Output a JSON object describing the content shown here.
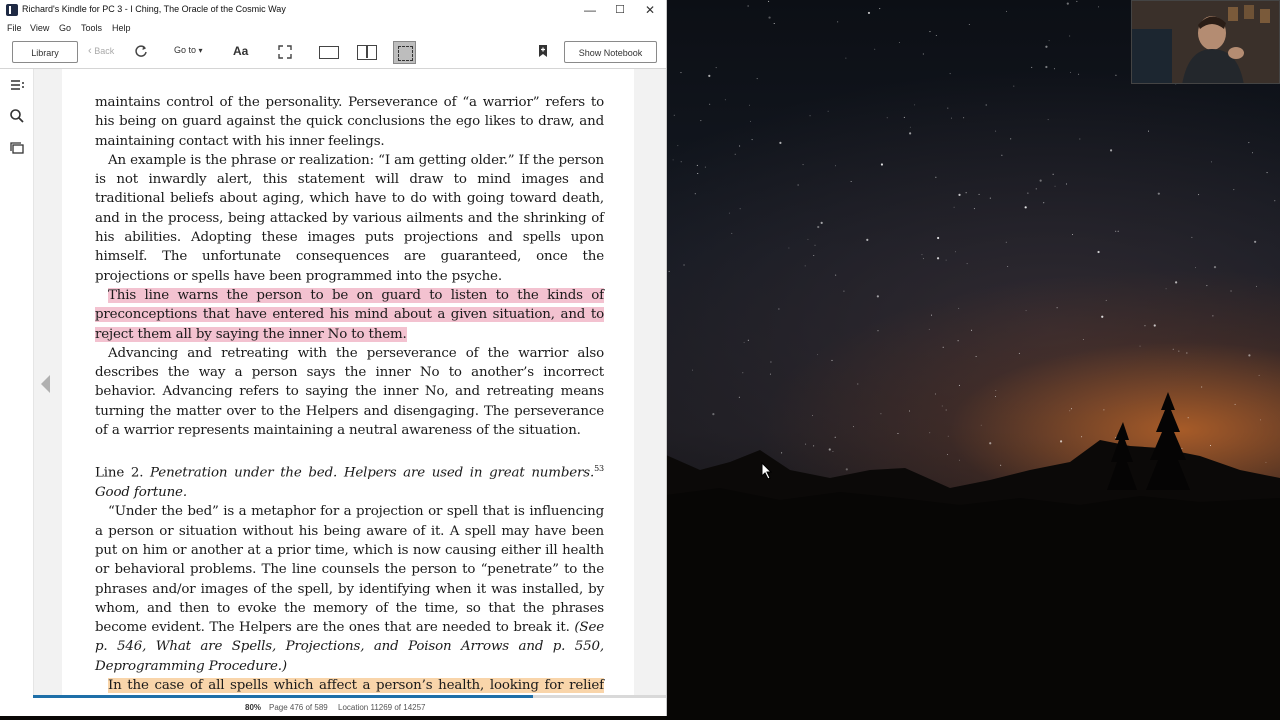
{
  "window": {
    "title": "Richard's Kindle for PC 3 - I Ching, The Oracle of the Cosmic Way",
    "controls": {
      "minimize": "—",
      "maximize": "☐",
      "close": "✕"
    }
  },
  "menu": [
    "File",
    "View",
    "Go",
    "Tools",
    "Help"
  ],
  "toolbar": {
    "library_label": "Library",
    "back_label": "Back",
    "goto_label": "Go to",
    "font_label": "Aa",
    "notebook_label": "Show Notebook"
  },
  "book": {
    "paragraphs": [
      {
        "text": "maintains control of the personality. Perseverance of “a warrior” refers to his being on guard against the quick conclusions the ego likes to draw, and maintain­ing contact with his inner feelings."
      },
      {
        "text": "An example is the phrase or realization: “I am getting older.” If the person is not inwardly alert, this statement will draw to mind images and traditional beliefs about aging, which have to do with going toward death, and in the process, being attacked by various ailments and the shrinking of his abilities. Adopting these images puts projections and spells upon himself. The unfortunate consequences are guaranteed, once the projections or spells have been programmed into the psyche."
      },
      {
        "text": "This line warns the person to be on guard to listen to the kinds of preconcep­tions that have entered his mind about a given situation, and to reject them all by saying the inner No to them."
      },
      {
        "text": "Advancing and retreating with the perseverance of the warrior also describes the way a person says the inner No to another’s incorrect behavior. Advancing refers to saying the inner No, and retreating means turning the matter over to the Helpers and disengaging. The perseverance of a warrior represents maintaining a neutral awareness of the situation."
      },
      {
        "line_label": "Line 2.",
        "line_text": "Penetration under the bed. Helpers are used in great numbers.",
        "footnote": "53",
        "line_end": " Good fortune."
      },
      {
        "text": "“Under the bed” is a metaphor for a projection or spell that is influencing a person or situation without his being aware of it. A spell may have been put on him or another at a prior time, which is now causing either ill health or behav­ioral problems. The line counsels the person to “penetrate” to the phrases and/or images of the spell, by identifying when it was installed, by whom, and then to evoke the memory of the time, so that the phrases become evident. The Helpers are the ones that are needed to break it.",
        "ref": "(See p. 546, What are Spells, Projections, and Poison Arrows and p. 550, Deprogramming Procedure.)"
      },
      {
        "text": "In the case of all spells which affect a person’s health, looking for relief from traditional sources, either in medicine, religion, science, or in the esoteric field,"
      }
    ]
  },
  "status": {
    "percent": "80%",
    "progress_fraction": 0.79,
    "page": "Page 476 of 589",
    "location": "Location 11269 of 14257"
  },
  "colors": {
    "highlight_pink": "#f3c2d0",
    "highlight_orange": "#f9d5aa",
    "progress": "#1e6fa8"
  },
  "icons": [
    "toc-icon",
    "search-icon",
    "flashcards-icon",
    "refresh-icon",
    "fullscreen-icon",
    "bookmark-icon",
    "prev-page-icon"
  ]
}
